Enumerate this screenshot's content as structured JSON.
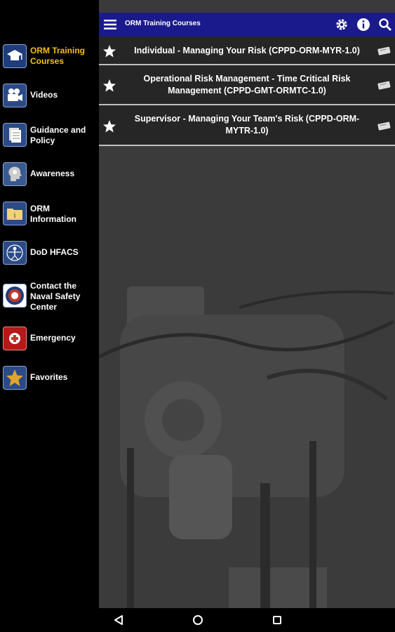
{
  "toolbar": {
    "title": "ORM Training Courses",
    "menu_icon": "hamburger-menu-icon",
    "settings_icon": "gear-icon",
    "info_icon": "info-icon",
    "search_icon": "search-icon",
    "color": "#1a1a8c"
  },
  "sidebar": {
    "active_color": "#f2c200",
    "items": [
      {
        "label": "ORM Training Courses",
        "icon": "graduation-cap-icon",
        "active": true
      },
      {
        "label": "Videos",
        "icon": "video-camera-icon"
      },
      {
        "label": "Guidance and Policy",
        "icon": "documents-icon"
      },
      {
        "label": "Awareness",
        "icon": "head-lightbulb-icon"
      },
      {
        "label": "ORM Information",
        "icon": "folder-info-icon"
      },
      {
        "label": "DoD HFACS",
        "icon": "hfacs-figure-icon"
      },
      {
        "label": "Contact the Naval Safety Center",
        "icon": "naval-safety-seal-icon"
      },
      {
        "label": "Emergency",
        "icon": "emergency-plus-icon"
      },
      {
        "label": "Favorites",
        "icon": "star-favorites-icon"
      }
    ]
  },
  "courses": [
    {
      "title": "Individual - Managing Your Risk (CPPD-ORM-MYR-1.0)",
      "icon": "star-icon",
      "action_icon": "certificate-icon"
    },
    {
      "title": "Operational Risk Management - Time Critical Risk Management (CPPD-GMT-ORMTC-1.0)",
      "icon": "star-icon",
      "action_icon": "certificate-icon"
    },
    {
      "title": "Supervisor - Managing Your Team's Risk (CPPD-ORM-MYTR-1.0)",
      "icon": "star-icon",
      "action_icon": "certificate-icon"
    }
  ],
  "navbar": {
    "back_icon": "back-triangle-icon",
    "home_icon": "home-circle-icon",
    "recents_icon": "recents-square-icon"
  }
}
